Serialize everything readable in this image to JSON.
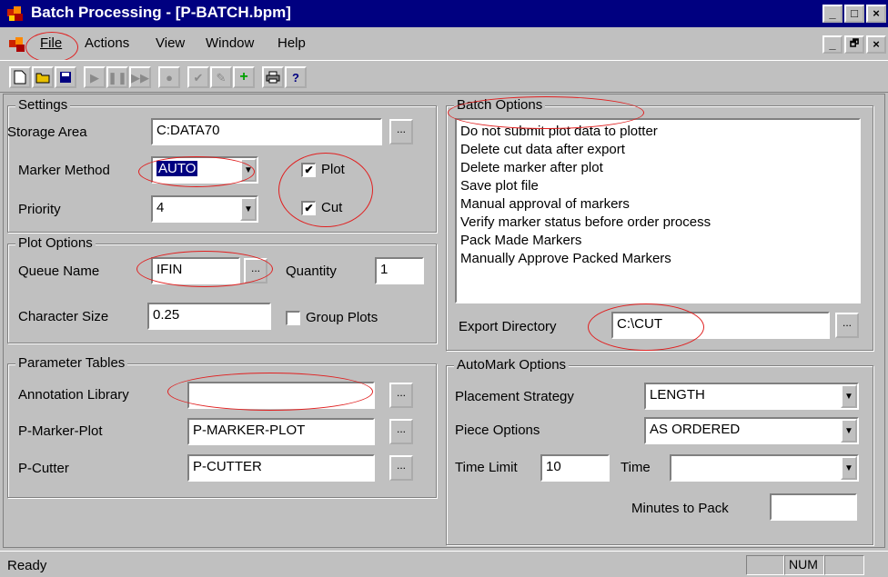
{
  "window": {
    "title": "Batch Processing - [P-BATCH.bpm]",
    "minimize": "_",
    "maximize": "□",
    "close": "×",
    "restore": "🗗"
  },
  "menu": {
    "items": [
      "File",
      "Actions",
      "View",
      "Window",
      "Help"
    ]
  },
  "settings": {
    "legend": "Settings",
    "storage_label": "Storage Area",
    "storage_value": "C:DATA70",
    "browse": "...",
    "marker_method_label": "Marker Method",
    "marker_method_value": "AUTO",
    "priority_label": "Priority",
    "priority_value": "4",
    "plot_label": "Plot",
    "plot_checked": true,
    "cut_label": "Cut",
    "cut_checked": true,
    "check_glyph": "✔"
  },
  "plot_options": {
    "legend": "Plot Options",
    "queue_label": "Queue Name",
    "queue_value": "IFIN",
    "quantity_label": "Quantity",
    "quantity_value": "1",
    "char_size_label": "Character Size",
    "char_size_value": "0.25",
    "group_plots_label": "Group Plots",
    "group_plots_checked": false
  },
  "parameter_tables": {
    "legend": "Parameter Tables",
    "annotation_label": "Annotation Library",
    "annotation_value": "",
    "marker_plot_label": "P-Marker-Plot",
    "marker_plot_value": "P-MARKER-PLOT",
    "cutter_label": "P-Cutter",
    "cutter_value": "P-CUTTER"
  },
  "batch_options": {
    "legend": "Batch Options",
    "items": [
      "Do not submit plot data to plotter",
      "Delete cut data after export",
      "Delete marker after plot",
      "Save plot file",
      "Manual approval of markers",
      "Verify marker status before order process",
      "Pack Made Markers",
      "Manually Approve Packed Markers"
    ],
    "export_label": "Export Directory",
    "export_value": "C:\\CUT"
  },
  "automark": {
    "legend": "AutoMark Options",
    "placement_label": "Placement Strategy",
    "placement_value": "LENGTH",
    "piece_label": "Piece Options",
    "piece_value": "AS ORDERED",
    "time_limit_label": "Time Limit",
    "time_limit_value": "10",
    "time_label": "Time",
    "time_value": "",
    "minutes_label": "Minutes to Pack",
    "minutes_value": ""
  },
  "status": {
    "text": "Ready",
    "num": "NUM"
  },
  "colors": {
    "annotation_circle": "#e02020",
    "title_bar": "#000080"
  }
}
